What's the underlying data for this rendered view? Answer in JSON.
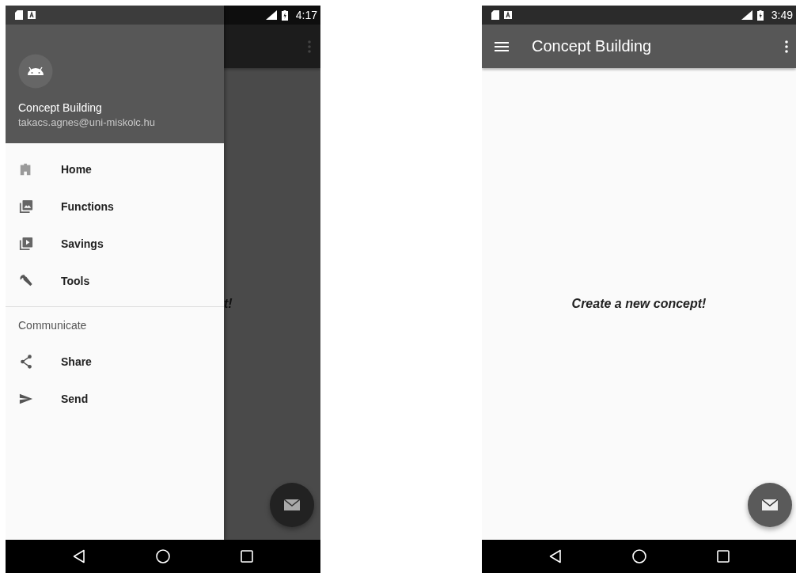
{
  "drawer_screen": {
    "status_bar": {
      "time": "4:17"
    },
    "drawer": {
      "open": true,
      "header": {
        "title": "Concept Building",
        "email": "takacs.agnes@uni-miskolc.hu"
      },
      "sections": [
        {
          "items": [
            {
              "label": "Home"
            },
            {
              "label": "Functions"
            },
            {
              "label": "Savings"
            },
            {
              "label": "Tools"
            }
          ]
        },
        {
          "heading": "Communicate",
          "items": [
            {
              "label": "Share"
            },
            {
              "label": "Send"
            }
          ]
        }
      ]
    },
    "content_fragment": "t!"
  },
  "main_screen": {
    "status_bar": {
      "time": "3:49"
    },
    "app_bar": {
      "title": "Concept Building"
    },
    "content": "Create a new concept!"
  }
}
